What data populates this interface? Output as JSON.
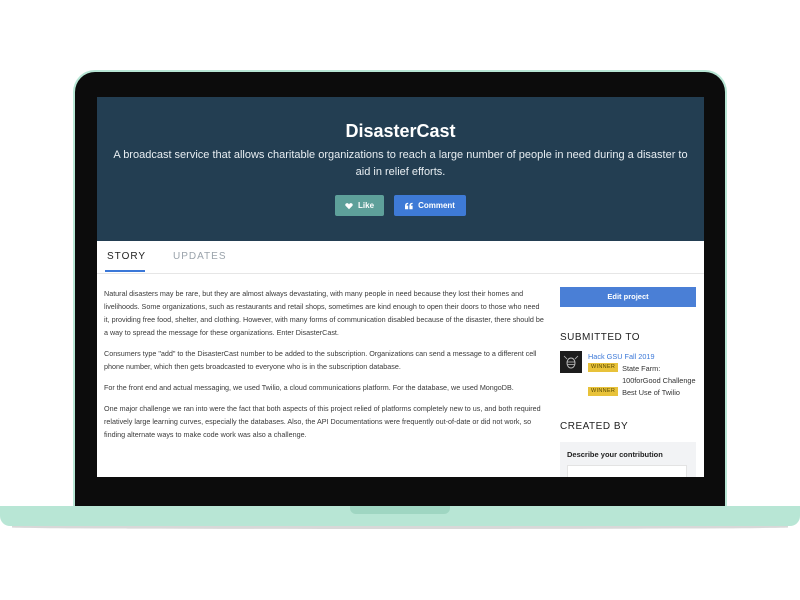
{
  "project": {
    "title": "DisasterCast",
    "tagline": "A broadcast service that allows charitable organizations to reach a large number of people in need during a disaster to aid in relief efforts.",
    "like_label": "Like",
    "comment_label": "Comment"
  },
  "tabs": [
    {
      "label": "STORY",
      "active": true
    },
    {
      "label": "UPDATES",
      "active": false
    }
  ],
  "story": {
    "paragraphs": [
      "Natural disasters may be rare, but they are almost always devastating, with many people in need because they lost their homes and livelihoods. Some organizations, such as restaurants and retail shops, sometimes are kind enough to open their doors to those who need it, providing free food, shelter, and clothing. However, with many forms of communication disabled because of the disaster, there should be a way to spread the message for these organizations. Enter DisasterCast.",
      "Consumers type \"add\" to the DisasterCast number to be added to the subscription. Organizations can send a message to a different cell phone number, which then gets broadcasted to everyone who is in the subscription database.",
      "For the front end and actual messaging, we used Twilio, a cloud communications platform. For the database, we used MongoDB.",
      "One major challenge we ran into were the fact that both aspects of this project relied of platforms completely new to us, and both required relatively large learning curves, especially the databases. Also, the API Documentations were frequently out-of-date or did not work, so finding alternate ways to make code work was also a challenge."
    ]
  },
  "sidebar": {
    "edit_label": "Edit project",
    "submitted_heading": "SUBMITTED TO",
    "hackathon_name": "Hack GSU Fall 2019",
    "prizes": [
      {
        "badge": "WINNER",
        "name": "State Farm: 100forGood Challenge"
      },
      {
        "badge": "WINNER",
        "name": "Best Use of Twilio"
      }
    ],
    "created_heading": "CREATED BY",
    "contribution_label": "Describe your contribution"
  },
  "colors": {
    "hero_bg": "#233e52",
    "accent_blue": "#3b78d8",
    "like_green": "#5ea09a",
    "winner_gold": "#e8c23a",
    "laptop_mint": "#b8e6d5"
  }
}
